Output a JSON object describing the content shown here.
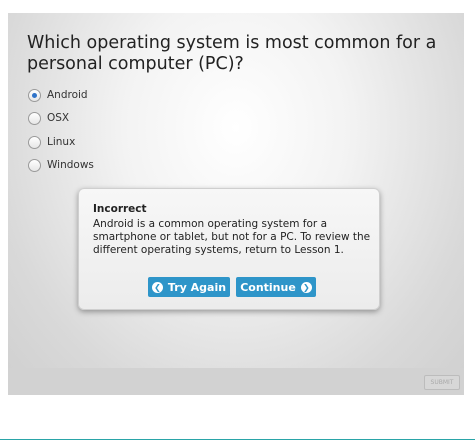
{
  "question": {
    "text": "Which operating system is most common for a personal computer (PC)?"
  },
  "options": [
    {
      "label": "Android",
      "selected": true
    },
    {
      "label": "OSX",
      "selected": false
    },
    {
      "label": "Linux",
      "selected": false
    },
    {
      "label": "Windows",
      "selected": false
    }
  ],
  "feedback": {
    "title": "Incorrect",
    "body": "Android is a common operating system for a smartphone or tablet, but not for a PC. To review the different operating systems, return to Lesson 1.",
    "try_again_label": "Try Again",
    "continue_label": "Continue",
    "try_again_icon": "chevron-left-circle-icon",
    "continue_icon": "chevron-right-circle-icon"
  },
  "footer": {
    "submit_label": "SUBMIT"
  },
  "colors": {
    "accent": "#2e95c9",
    "radio_selected": "#2f73c9",
    "bottom_line": "#2aa5a8"
  }
}
